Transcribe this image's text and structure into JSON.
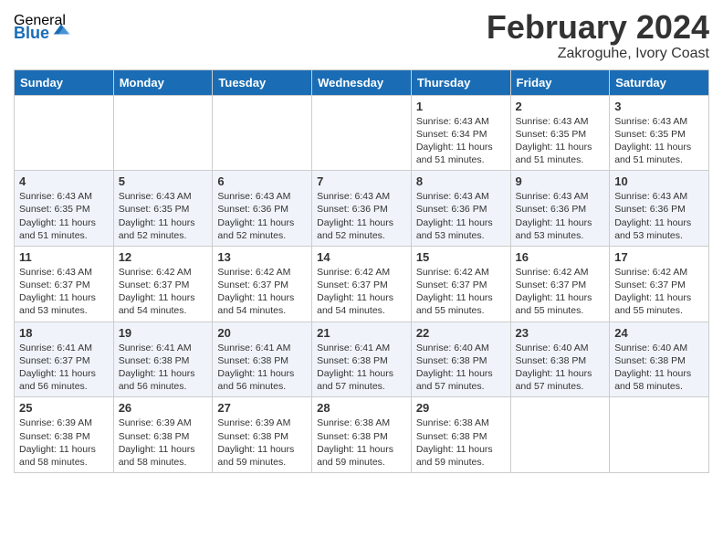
{
  "header": {
    "logo_general": "General",
    "logo_blue": "Blue",
    "title": "February 2024",
    "subtitle": "Zakroguhe, Ivory Coast"
  },
  "days_of_week": [
    "Sunday",
    "Monday",
    "Tuesday",
    "Wednesday",
    "Thursday",
    "Friday",
    "Saturday"
  ],
  "weeks": [
    [
      {
        "day": "",
        "info": ""
      },
      {
        "day": "",
        "info": ""
      },
      {
        "day": "",
        "info": ""
      },
      {
        "day": "",
        "info": ""
      },
      {
        "day": "1",
        "info": "Sunrise: 6:43 AM\nSunset: 6:34 PM\nDaylight: 11 hours\nand 51 minutes."
      },
      {
        "day": "2",
        "info": "Sunrise: 6:43 AM\nSunset: 6:35 PM\nDaylight: 11 hours\nand 51 minutes."
      },
      {
        "day": "3",
        "info": "Sunrise: 6:43 AM\nSunset: 6:35 PM\nDaylight: 11 hours\nand 51 minutes."
      }
    ],
    [
      {
        "day": "4",
        "info": "Sunrise: 6:43 AM\nSunset: 6:35 PM\nDaylight: 11 hours\nand 51 minutes."
      },
      {
        "day": "5",
        "info": "Sunrise: 6:43 AM\nSunset: 6:35 PM\nDaylight: 11 hours\nand 52 minutes."
      },
      {
        "day": "6",
        "info": "Sunrise: 6:43 AM\nSunset: 6:36 PM\nDaylight: 11 hours\nand 52 minutes."
      },
      {
        "day": "7",
        "info": "Sunrise: 6:43 AM\nSunset: 6:36 PM\nDaylight: 11 hours\nand 52 minutes."
      },
      {
        "day": "8",
        "info": "Sunrise: 6:43 AM\nSunset: 6:36 PM\nDaylight: 11 hours\nand 53 minutes."
      },
      {
        "day": "9",
        "info": "Sunrise: 6:43 AM\nSunset: 6:36 PM\nDaylight: 11 hours\nand 53 minutes."
      },
      {
        "day": "10",
        "info": "Sunrise: 6:43 AM\nSunset: 6:36 PM\nDaylight: 11 hours\nand 53 minutes."
      }
    ],
    [
      {
        "day": "11",
        "info": "Sunrise: 6:43 AM\nSunset: 6:37 PM\nDaylight: 11 hours\nand 53 minutes."
      },
      {
        "day": "12",
        "info": "Sunrise: 6:42 AM\nSunset: 6:37 PM\nDaylight: 11 hours\nand 54 minutes."
      },
      {
        "day": "13",
        "info": "Sunrise: 6:42 AM\nSunset: 6:37 PM\nDaylight: 11 hours\nand 54 minutes."
      },
      {
        "day": "14",
        "info": "Sunrise: 6:42 AM\nSunset: 6:37 PM\nDaylight: 11 hours\nand 54 minutes."
      },
      {
        "day": "15",
        "info": "Sunrise: 6:42 AM\nSunset: 6:37 PM\nDaylight: 11 hours\nand 55 minutes."
      },
      {
        "day": "16",
        "info": "Sunrise: 6:42 AM\nSunset: 6:37 PM\nDaylight: 11 hours\nand 55 minutes."
      },
      {
        "day": "17",
        "info": "Sunrise: 6:42 AM\nSunset: 6:37 PM\nDaylight: 11 hours\nand 55 minutes."
      }
    ],
    [
      {
        "day": "18",
        "info": "Sunrise: 6:41 AM\nSunset: 6:37 PM\nDaylight: 11 hours\nand 56 minutes."
      },
      {
        "day": "19",
        "info": "Sunrise: 6:41 AM\nSunset: 6:38 PM\nDaylight: 11 hours\nand 56 minutes."
      },
      {
        "day": "20",
        "info": "Sunrise: 6:41 AM\nSunset: 6:38 PM\nDaylight: 11 hours\nand 56 minutes."
      },
      {
        "day": "21",
        "info": "Sunrise: 6:41 AM\nSunset: 6:38 PM\nDaylight: 11 hours\nand 57 minutes."
      },
      {
        "day": "22",
        "info": "Sunrise: 6:40 AM\nSunset: 6:38 PM\nDaylight: 11 hours\nand 57 minutes."
      },
      {
        "day": "23",
        "info": "Sunrise: 6:40 AM\nSunset: 6:38 PM\nDaylight: 11 hours\nand 57 minutes."
      },
      {
        "day": "24",
        "info": "Sunrise: 6:40 AM\nSunset: 6:38 PM\nDaylight: 11 hours\nand 58 minutes."
      }
    ],
    [
      {
        "day": "25",
        "info": "Sunrise: 6:39 AM\nSunset: 6:38 PM\nDaylight: 11 hours\nand 58 minutes."
      },
      {
        "day": "26",
        "info": "Sunrise: 6:39 AM\nSunset: 6:38 PM\nDaylight: 11 hours\nand 58 minutes."
      },
      {
        "day": "27",
        "info": "Sunrise: 6:39 AM\nSunset: 6:38 PM\nDaylight: 11 hours\nand 59 minutes."
      },
      {
        "day": "28",
        "info": "Sunrise: 6:38 AM\nSunset: 6:38 PM\nDaylight: 11 hours\nand 59 minutes."
      },
      {
        "day": "29",
        "info": "Sunrise: 6:38 AM\nSunset: 6:38 PM\nDaylight: 11 hours\nand 59 minutes."
      },
      {
        "day": "",
        "info": ""
      },
      {
        "day": "",
        "info": ""
      }
    ]
  ]
}
